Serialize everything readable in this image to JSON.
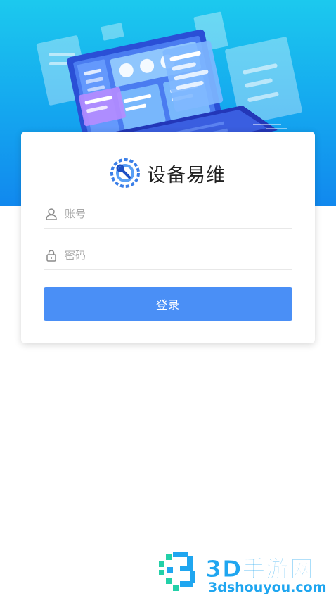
{
  "app": {
    "title": "设备易维"
  },
  "login_form": {
    "account_placeholder": "账号",
    "password_placeholder": "密码",
    "submit_label": "登录"
  },
  "watermark": {
    "brand": "3D手游网",
    "url": "3dshouyou.com"
  },
  "colors": {
    "hero_top": "#1cc9ee",
    "hero_bottom": "#1188ee",
    "button": "#4a8ff6",
    "watermark": "#1fa6f0"
  },
  "icons": {
    "brand": "wrench-gear-icon",
    "account": "user-icon",
    "password": "lock-icon"
  }
}
